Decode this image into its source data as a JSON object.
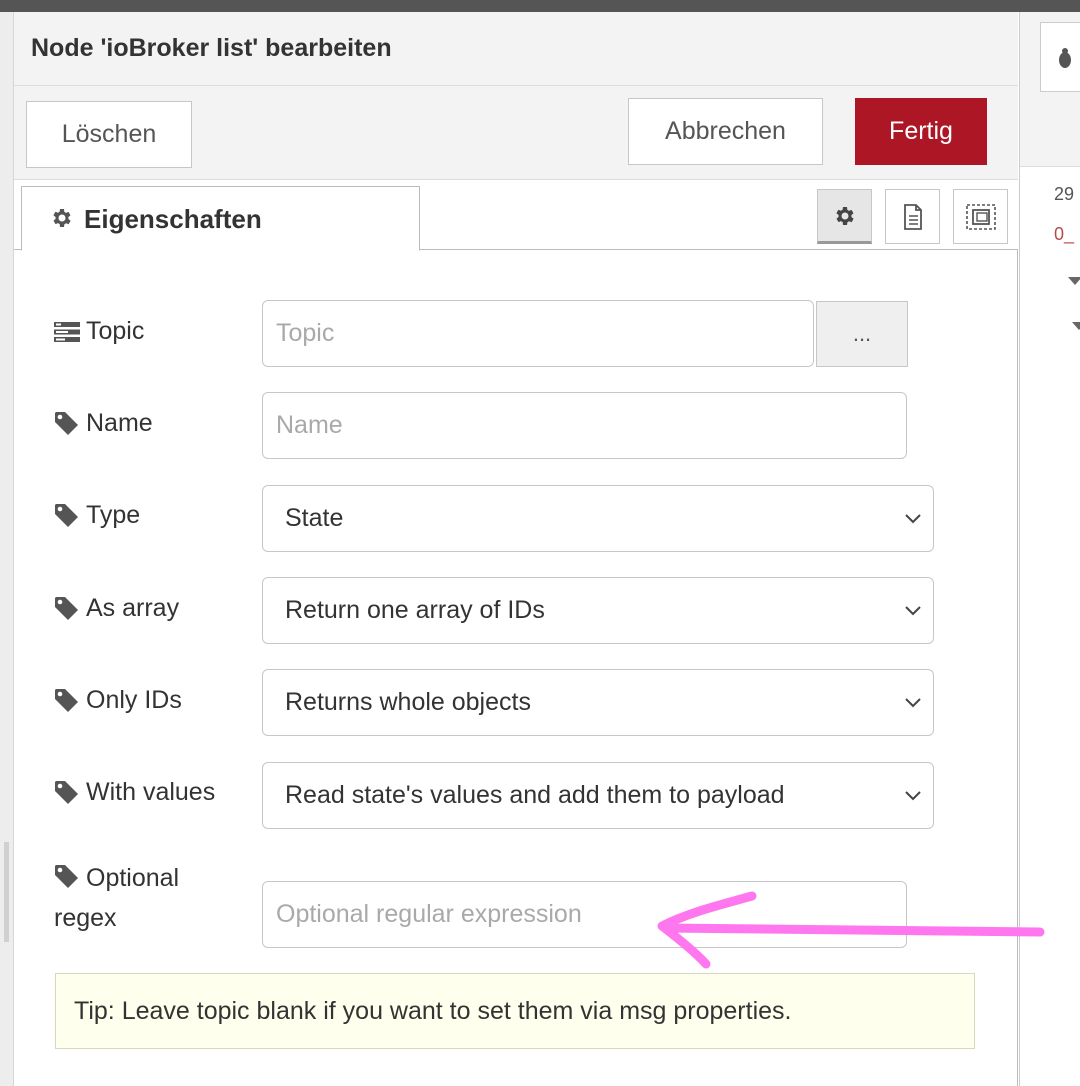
{
  "dialog": {
    "title": "Node 'ioBroker list' bearbeiten",
    "delete_label": "Löschen",
    "cancel_label": "Abbrechen",
    "done_label": "Fertig",
    "accent_color": "#ad1625"
  },
  "tabs": {
    "properties_label": "Eigenschaften",
    "icons": [
      "gear-icon",
      "document-icon",
      "appearance-icon"
    ]
  },
  "form": {
    "topic": {
      "label": "Topic",
      "placeholder": "Topic",
      "browse_label": "..."
    },
    "name": {
      "label": "Name",
      "placeholder": "Name"
    },
    "type": {
      "label": "Type",
      "value": "State"
    },
    "as_array": {
      "label": "As array",
      "value": "Return one array of IDs"
    },
    "only_ids": {
      "label": "Only IDs",
      "value": "Returns whole objects"
    },
    "with_values": {
      "label": "With values",
      "value": "Read state's values and add them to payload"
    },
    "regex": {
      "label_line1": "Optional",
      "label_line2": "regex",
      "placeholder": "Optional regular expression"
    }
  },
  "tip": "Tip: Leave topic blank if you want to set them via msg properties.",
  "sidebar": {
    "line1": "29",
    "line2": "0_"
  },
  "annotation": {
    "type": "arrow",
    "color": "#ff77ee"
  }
}
